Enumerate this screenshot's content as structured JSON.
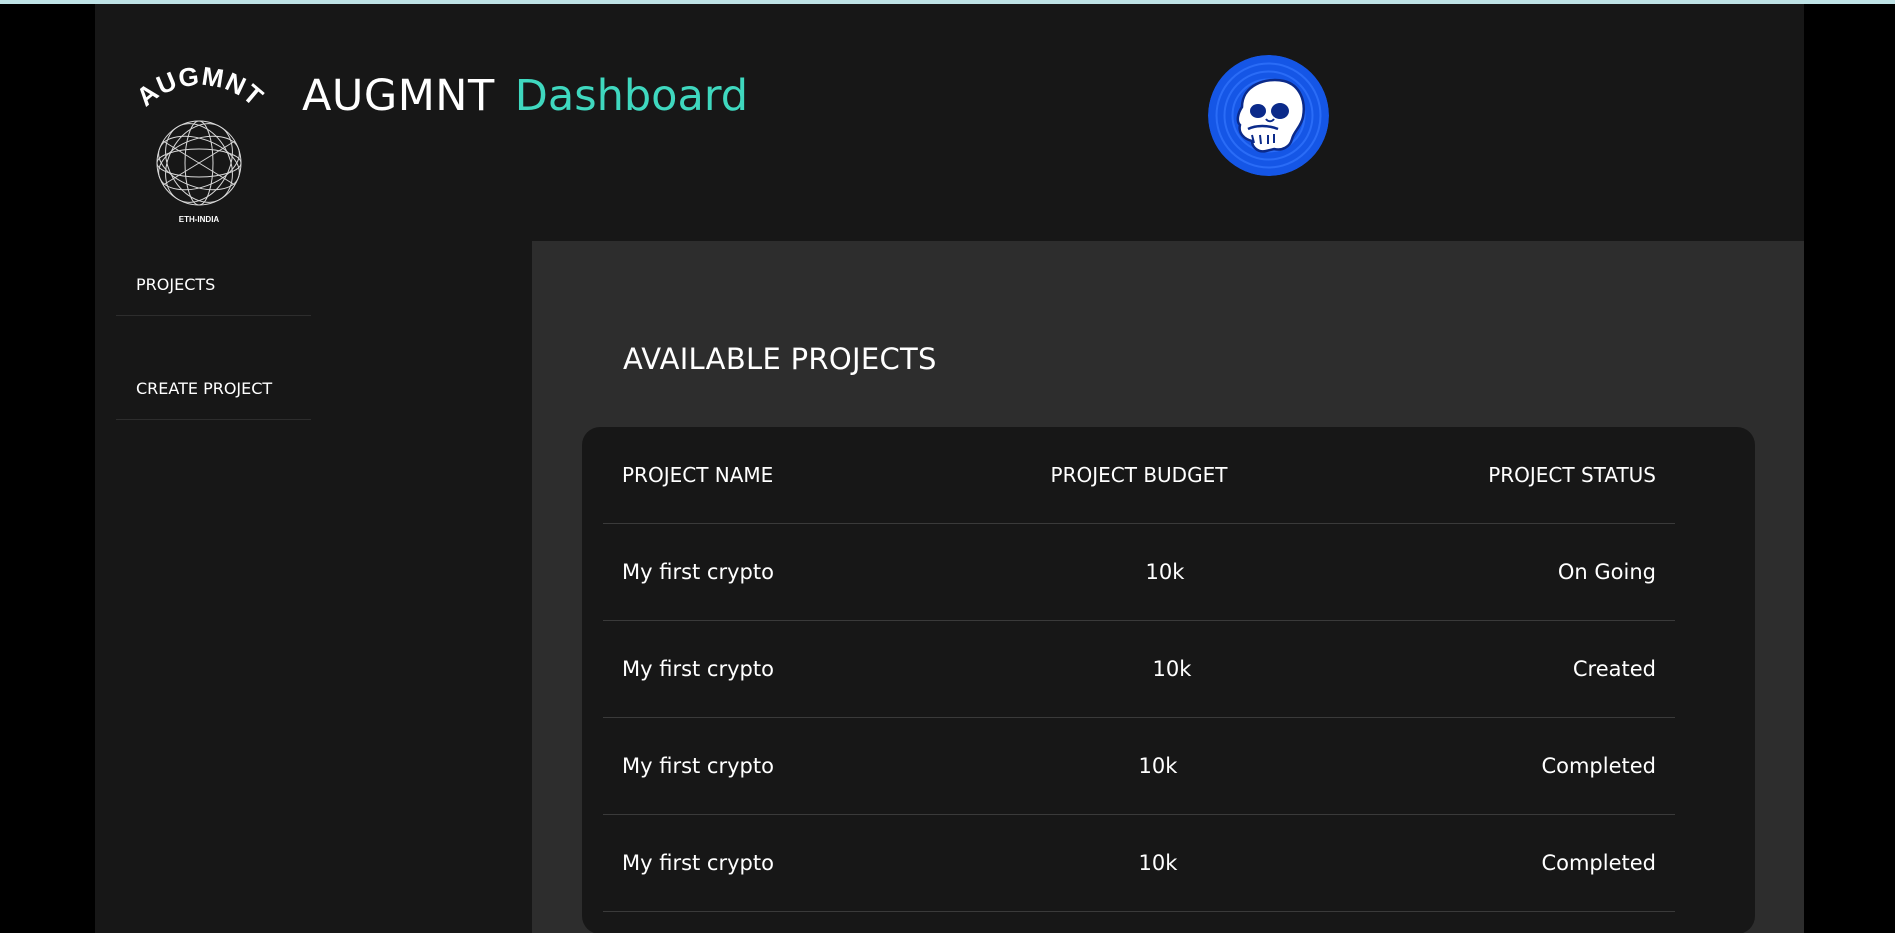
{
  "header": {
    "brand_name": "AUGMNT",
    "brand_sub": "Dashboard",
    "logo_text": "AUGMNT",
    "logo_subtext": "ETH-INDIA"
  },
  "sidebar": {
    "items": [
      {
        "label": "PROJECTS"
      },
      {
        "label": "CREATE PROJECT"
      }
    ]
  },
  "main": {
    "title": "AVAILABLE PROJECTS",
    "table": {
      "columns": [
        "PROJECT NAME",
        "PROJECT BUDGET",
        "PROJECT STATUS"
      ],
      "rows": [
        {
          "name": "My first crypto",
          "budget": "10k",
          "status": "On Going"
        },
        {
          "name": "My first crypto",
          "budget": "10k",
          "status": "Created"
        },
        {
          "name": "My first crypto",
          "budget": "10k",
          "status": "Completed"
        },
        {
          "name": "My first crypto",
          "budget": "10k",
          "status": "Completed"
        }
      ]
    }
  },
  "colors": {
    "accent": "#3fd8bf",
    "panel": "#171717",
    "main_bg": "#2d2d2d",
    "avatar_bg": "#1556e6"
  }
}
